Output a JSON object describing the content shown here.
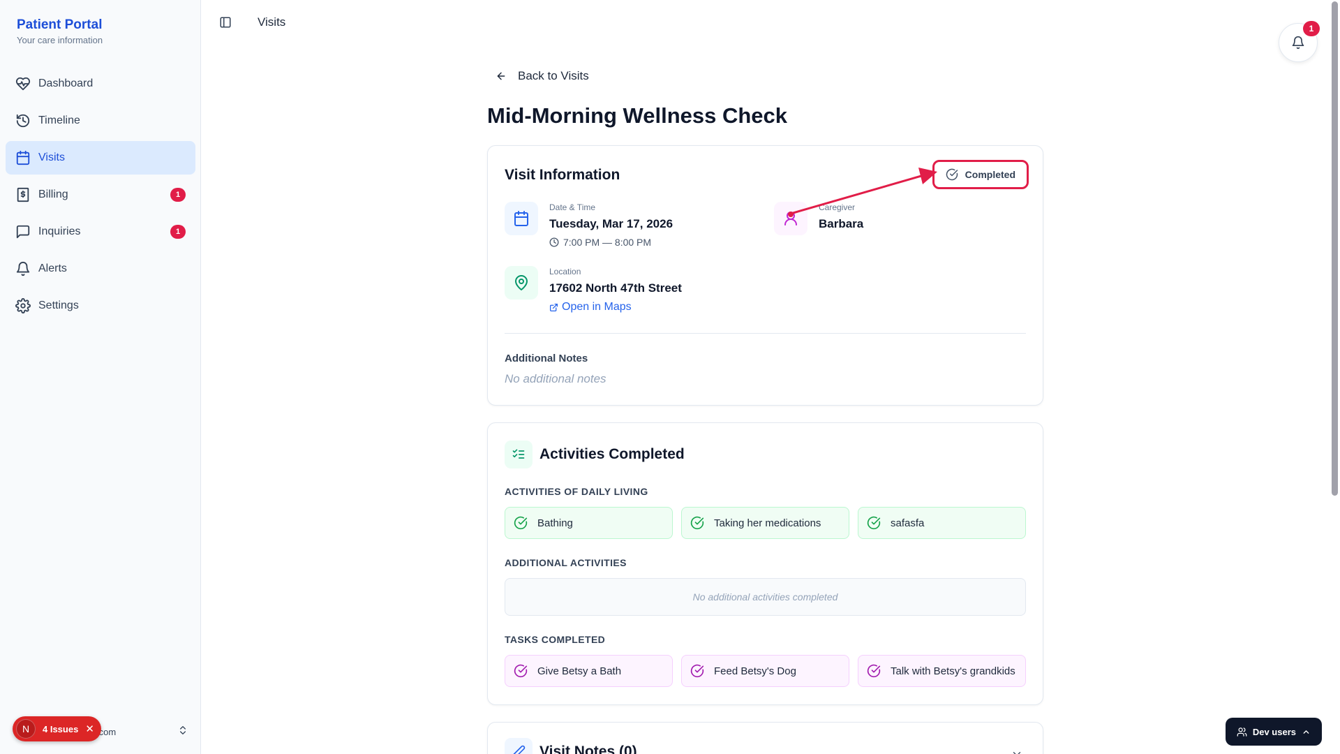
{
  "app": {
    "title": "Patient Portal",
    "subtitle": "Your care information"
  },
  "sidebar": {
    "items": [
      {
        "label": "Dashboard",
        "icon": "heart-pulse-icon",
        "active": false,
        "badge": ""
      },
      {
        "label": "Timeline",
        "icon": "history-icon",
        "active": false,
        "badge": ""
      },
      {
        "label": "Visits",
        "icon": "calendar-icon",
        "active": true,
        "badge": ""
      },
      {
        "label": "Billing",
        "icon": "dollar-receipt-icon",
        "active": false,
        "badge": "1"
      },
      {
        "label": "Inquiries",
        "icon": "message-square-icon",
        "active": false,
        "badge": "1"
      },
      {
        "label": "Alerts",
        "icon": "bell-icon",
        "active": false,
        "badge": ""
      },
      {
        "label": "Settings",
        "icon": "gear-icon",
        "active": false,
        "badge": ""
      }
    ],
    "user_email_fragment": ".com",
    "issues": {
      "letter": "N",
      "label": "4 Issues"
    }
  },
  "topbar": {
    "breadcrumb": "Visits",
    "notification_count": "1"
  },
  "page": {
    "back_label": "Back to Visits",
    "title": "Mid-Morning Wellness Check"
  },
  "visit_info": {
    "heading": "Visit Information",
    "status": "Completed",
    "datetime_label": "Date & Time",
    "date": "Tuesday, Mar 17, 2026",
    "time": "7:00 PM — 8:00 PM",
    "caregiver_label": "Caregiver",
    "caregiver": "Barbara",
    "location_label": "Location",
    "location": "17602 North 47th Street",
    "maps_label": "Open in Maps",
    "notes_label": "Additional Notes",
    "notes_value": "No additional notes"
  },
  "activities": {
    "heading": "Activities Completed",
    "adl_label": "ACTIVITIES OF DAILY LIVING",
    "adl_items": [
      "Bathing",
      "Taking her medications",
      "safasfa"
    ],
    "additional_label": "ADDITIONAL ACTIVITIES",
    "additional_empty": "No additional activities completed",
    "tasks_label": "TASKS COMPLETED",
    "tasks": [
      "Give Betsy a Bath",
      "Feed Betsy's Dog",
      "Talk with Betsy's grandkids"
    ]
  },
  "visit_notes": {
    "heading": "Visit Notes (0)"
  },
  "dev": {
    "label": "Dev users"
  },
  "colors": {
    "accent": "#1d4ed8",
    "badge": "#e11d48",
    "success": "#16a34a",
    "task": "#a21caf"
  }
}
